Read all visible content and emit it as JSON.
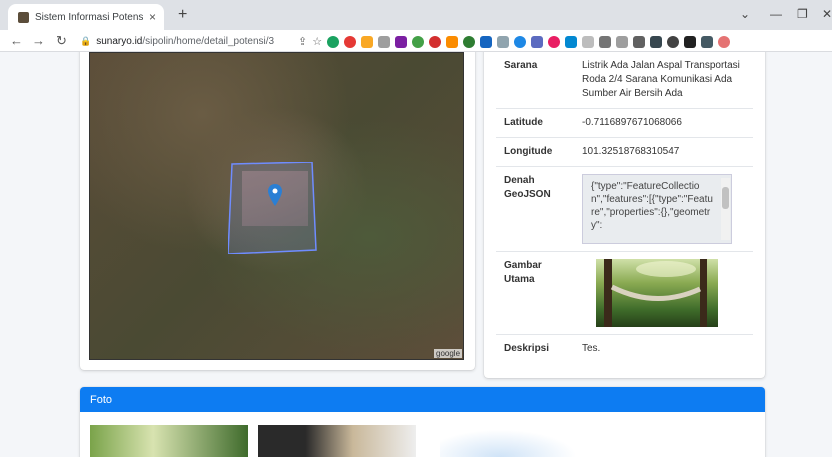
{
  "browser": {
    "tab_title": "Sistem Informasi Potensi dan Pel",
    "url_host": "sunaryo.id",
    "url_path": "/sipolin/home/detail_potensi/3",
    "new_tab": "+",
    "close_tab": "×"
  },
  "map": {
    "attribution": "google"
  },
  "details": {
    "sarana_label": "Sarana",
    "sarana_value": "Listrik Ada Jalan Aspal Transportasi Roda 2/4 Sarana Komunikasi Ada Sumber Air Bersih Ada",
    "latitude_label": "Latitude",
    "latitude_value": "-0.7116897671068066",
    "longitude_label": "Longitude",
    "longitude_value": "101.32518768310547",
    "geojson_label": "Denah GeoJSON",
    "geojson_value": "{\"type\":\"FeatureCollection\",\"features\":[{\"type\":\"Feature\",\"properties\":{},\"geometry\":",
    "gambar_label": "Gambar Utama",
    "deskripsi_label": "Deskripsi",
    "deskripsi_value": "Tes."
  },
  "foto": {
    "title": "Foto"
  }
}
